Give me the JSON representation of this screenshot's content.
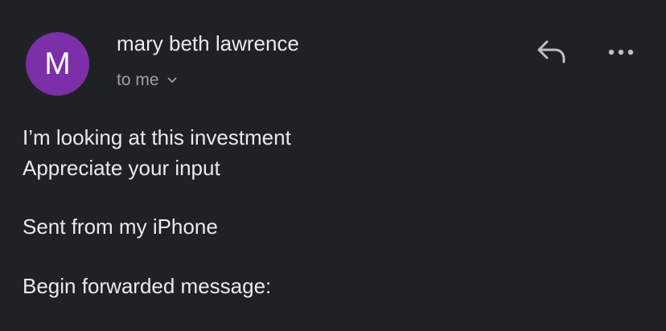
{
  "header": {
    "avatar_letter": "M",
    "avatar_color": "#7b2fa8",
    "sender_name": "mary beth lawrence",
    "recipient_label": "to me",
    "reply_icon": "reply-icon",
    "more_icon": "more-horizontal-icon",
    "chevron_icon": "chevron-down-icon"
  },
  "message": {
    "lines": [
      "I’m looking at this investment",
      "Appreciate your input",
      "Sent from my iPhone",
      "Begin forwarded message:"
    ]
  }
}
